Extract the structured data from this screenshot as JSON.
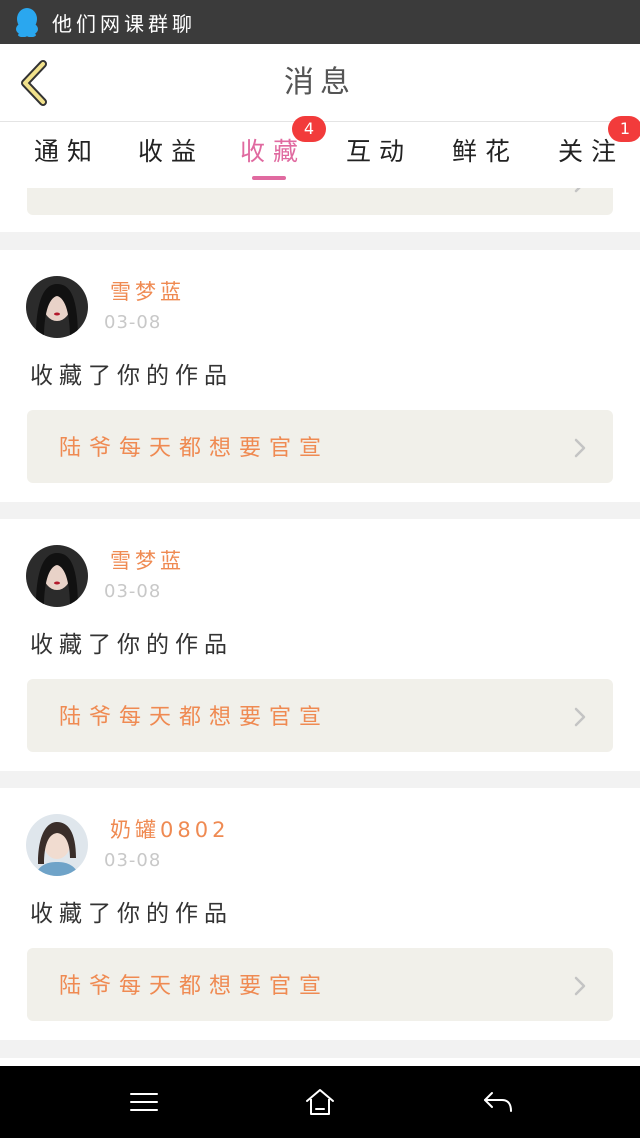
{
  "status_bar": {
    "app_icon": "qq-penguin-icon",
    "text": "他们网课群聊"
  },
  "header": {
    "back_icon": "back-chevron-icon",
    "title": "消息"
  },
  "tabs": [
    {
      "label": "通知"
    },
    {
      "label": "收益"
    },
    {
      "label": "收藏",
      "badge": "4",
      "active": true
    },
    {
      "label": "互动"
    },
    {
      "label": "鲜花"
    },
    {
      "label": "关注",
      "badge": "1"
    }
  ],
  "feed": {
    "items": [
      {
        "username": "雪梦蓝",
        "date": "03-08",
        "action": "收藏了你的作品",
        "work_title": "陆爷每天都想要官宣"
      },
      {
        "username": "雪梦蓝",
        "date": "03-08",
        "action": "收藏了你的作品",
        "work_title": "陆爷每天都想要官宣"
      },
      {
        "username": "奶罐0802",
        "date": "03-08",
        "action": "收藏了你的作品",
        "work_title": "陆爷每天都想要官宣"
      }
    ]
  },
  "nav_bar": {
    "menu_icon": "menu-icon",
    "home_icon": "home-icon",
    "back_icon": "back-arrow-icon"
  },
  "colors": {
    "accent_pink": "#e06aa0",
    "orange_text": "#ef8a52",
    "badge_red": "#f23b3b",
    "card_bg": "#f1f0ea"
  }
}
